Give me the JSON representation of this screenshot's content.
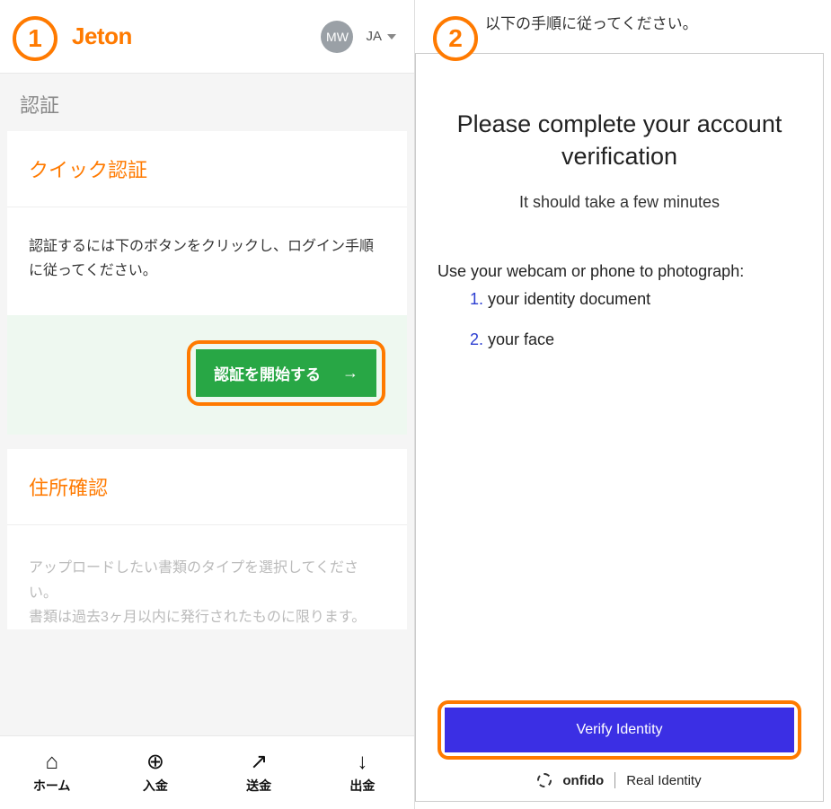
{
  "steps": {
    "one": "1",
    "two": "2"
  },
  "left": {
    "logo": "Jeton",
    "avatar_initials": "MW",
    "language": "JA",
    "page_title": "認証",
    "quick_auth": {
      "title": "クイック認証",
      "body": "認証するには下のボタンをクリックし、ログイン手順に従ってください。",
      "button": "認証を開始する"
    },
    "address": {
      "title": "住所確認",
      "body": "アップロードしたい書類のタイプを選択してください。\n書類は過去3ヶ月以内に発行されたものに限ります。"
    },
    "nav": {
      "home": "ホーム",
      "deposit": "入金",
      "send": "送金",
      "withdraw": "出金"
    }
  },
  "right": {
    "top_text": "以下の手順に従ってください。",
    "title": "Please complete your account verification",
    "subtitle": "It should take a few minutes",
    "instruction": "Use your webcam or phone to photograph:",
    "list": {
      "item1_num": "1.",
      "item1_text": " your identity document",
      "item2_num": "2.",
      "item2_text": " your face"
    },
    "verify_button": "Verify Identity",
    "brand_name": "onfido",
    "brand_tag": "Real Identity"
  }
}
